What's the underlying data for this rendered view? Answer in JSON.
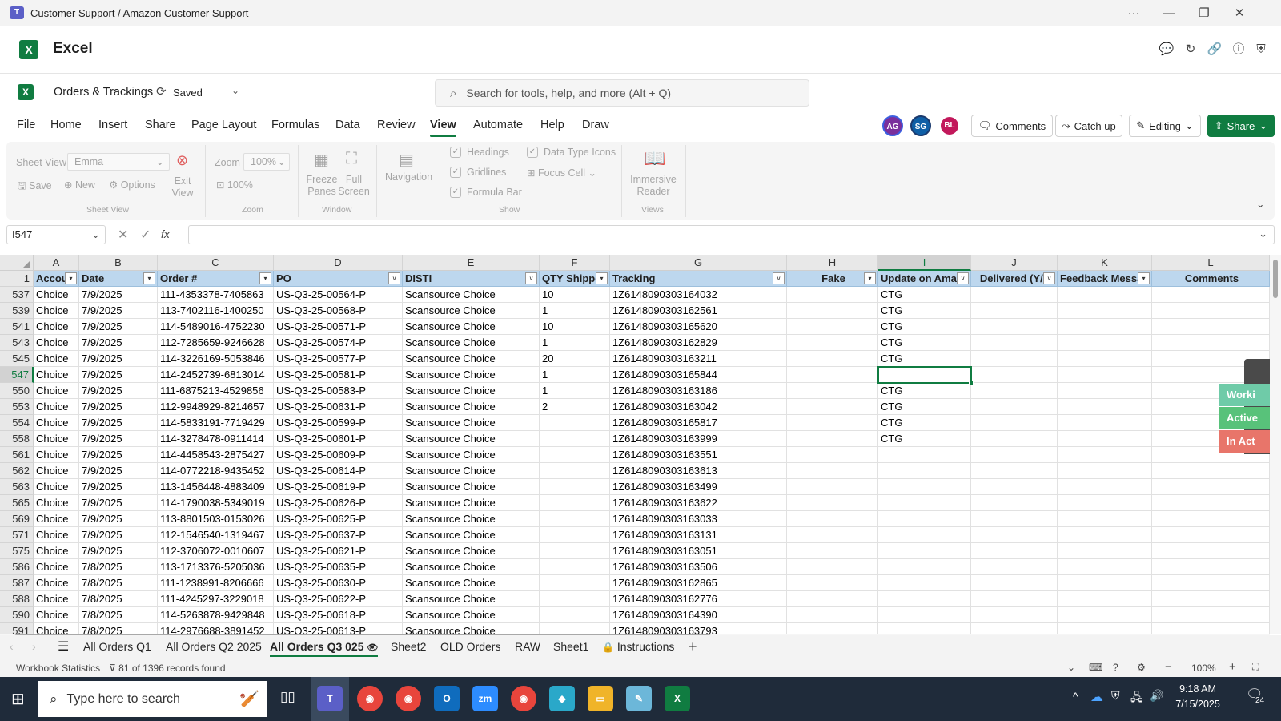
{
  "window": {
    "title": "Customer Support / Amazon Customer Support",
    "more": "···",
    "minimize": "—",
    "restore": "❐",
    "close": "✕"
  },
  "app": {
    "name": "Excel",
    "logo": "X"
  },
  "doc": {
    "name": "Orders & Trackings",
    "saved": "Saved",
    "search_placeholder": "Search for tools, help, and more (Alt + Q)"
  },
  "menu": [
    "File",
    "Home",
    "Insert",
    "Share",
    "Page Layout",
    "Formulas",
    "Data",
    "Review",
    "View",
    "Automate",
    "Help",
    "Draw"
  ],
  "avatars": [
    {
      "initials": "AG",
      "color": "#7a2f9c"
    },
    {
      "initials": "SG",
      "color": "#0f5fa6"
    },
    {
      "initials": "BL",
      "color": "#c2185b"
    }
  ],
  "actions": {
    "comments": "Comments",
    "catchup": "Catch up",
    "editing": "Editing",
    "share": "Share"
  },
  "ribbon": {
    "sheet_view_label": "Sheet View",
    "sheet_view_value": "Emma",
    "save": "Save",
    "new": "New",
    "options": "Options",
    "exit_view": "Exit View",
    "group_sheet_view": "Sheet View",
    "zoom_label": "Zoom",
    "zoom_value": "100%",
    "zoom_100": "100%",
    "group_zoom": "Zoom",
    "freeze_panes": "Freeze Panes",
    "full_screen": "Full Screen",
    "group_window": "Window",
    "navigation": "Navigation",
    "headings": "Headings",
    "gridlines": "Gridlines",
    "formula_bar": "Formula Bar",
    "data_type_icons": "Data Type Icons",
    "focus_cell": "Focus Cell",
    "group_show": "Show",
    "immersive_reader": "Immersive Reader",
    "group_views": "Views"
  },
  "formula_bar": {
    "name_box": "I547",
    "fx": "fx",
    "content": ""
  },
  "grid": {
    "columns": [
      "A",
      "B",
      "C",
      "D",
      "E",
      "F",
      "G",
      "H",
      "I",
      "J",
      "K",
      "L"
    ],
    "header_row_num": "1",
    "headers": [
      "Accou",
      "Date",
      "Order #",
      "PO",
      "DISTI",
      "QTY Shipped",
      "Tracking",
      "Fake",
      "Update on Amaz",
      "Delivered (Y/N",
      "Feedback Messa",
      "Comments"
    ],
    "rows": [
      {
        "num": "537",
        "cells": [
          "Choice",
          "7/9/2025",
          "111-4353378-7405863",
          "US-Q3-25-00564-P",
          "Scansource Choice",
          "10",
          "1Z6148090303164032",
          "",
          "CTG",
          "",
          "",
          ""
        ]
      },
      {
        "num": "539",
        "cells": [
          "Choice",
          "7/9/2025",
          "113-7402116-1400250",
          "US-Q3-25-00568-P",
          "Scansource Choice",
          "1",
          "1Z6148090303162561",
          "",
          "CTG",
          "",
          "",
          ""
        ]
      },
      {
        "num": "541",
        "cells": [
          "Choice",
          "7/9/2025",
          "114-5489016-4752230",
          "US-Q3-25-00571-P",
          "Scansource Choice",
          "10",
          "1Z6148090303165620",
          "",
          "CTG",
          "",
          "",
          ""
        ]
      },
      {
        "num": "543",
        "cells": [
          "Choice",
          "7/9/2025",
          "112-7285659-9246628",
          "US-Q3-25-00574-P",
          "Scansource Choice",
          "1",
          "1Z6148090303162829",
          "",
          "CTG",
          "",
          "",
          ""
        ]
      },
      {
        "num": "545",
        "cells": [
          "Choice",
          "7/9/2025",
          "114-3226169-5053846",
          "US-Q3-25-00577-P",
          "Scansource Choice",
          "20",
          "1Z6148090303163211",
          "",
          "CTG",
          "",
          "",
          ""
        ]
      },
      {
        "num": "547",
        "cells": [
          "Choice",
          "7/9/2025",
          "114-2452739-6813014",
          "US-Q3-25-00581-P",
          "Scansource Choice",
          "1",
          "1Z6148090303165844",
          "",
          "",
          "",
          "",
          ""
        ]
      },
      {
        "num": "550",
        "cells": [
          "Choice",
          "7/9/2025",
          "111-6875213-4529856",
          "US-Q3-25-00583-P",
          "Scansource Choice",
          "1",
          "1Z6148090303163186",
          "",
          "CTG",
          "",
          "",
          ""
        ]
      },
      {
        "num": "553",
        "cells": [
          "Choice",
          "7/9/2025",
          "112-9948929-8214657",
          "US-Q3-25-00631-P",
          "Scansource Choice",
          "2",
          "1Z6148090303163042",
          "",
          "CTG",
          "",
          "",
          ""
        ]
      },
      {
        "num": "554",
        "cells": [
          "Choice",
          "7/9/2025",
          "114-5833191-7719429",
          "US-Q3-25-00599-P",
          "Scansource Choice",
          "",
          "1Z6148090303165817",
          "",
          "CTG",
          "",
          "",
          ""
        ]
      },
      {
        "num": "558",
        "cells": [
          "Choice",
          "7/9/2025",
          "114-3278478-0911414",
          "US-Q3-25-00601-P",
          "Scansource Choice",
          "",
          "1Z6148090303163999",
          "",
          "CTG",
          "",
          "",
          ""
        ]
      },
      {
        "num": "561",
        "cells": [
          "Choice",
          "7/9/2025",
          "114-4458543-2875427",
          "US-Q3-25-00609-P",
          "Scansource Choice",
          "",
          "1Z6148090303163551",
          "",
          "",
          "",
          "",
          ""
        ]
      },
      {
        "num": "562",
        "cells": [
          "Choice",
          "7/9/2025",
          "114-0772218-9435452",
          "US-Q3-25-00614-P",
          "Scansource Choice",
          "",
          "1Z6148090303163613",
          "",
          "",
          "",
          "",
          ""
        ]
      },
      {
        "num": "563",
        "cells": [
          "Choice",
          "7/9/2025",
          "113-1456448-4883409",
          "US-Q3-25-00619-P",
          "Scansource Choice",
          "",
          "1Z6148090303163499",
          "",
          "",
          "",
          "",
          ""
        ]
      },
      {
        "num": "565",
        "cells": [
          "Choice",
          "7/9/2025",
          "114-1790038-5349019",
          "US-Q3-25-00626-P",
          "Scansource Choice",
          "",
          "1Z6148090303163622",
          "",
          "",
          "",
          "",
          ""
        ]
      },
      {
        "num": "569",
        "cells": [
          "Choice",
          "7/9/2025",
          "113-8801503-0153026",
          "US-Q3-25-00625-P",
          "Scansource Choice",
          "",
          "1Z6148090303163033",
          "",
          "",
          "",
          "",
          ""
        ]
      },
      {
        "num": "571",
        "cells": [
          "Choice",
          "7/9/2025",
          "112-1546540-1319467",
          "US-Q3-25-00637-P",
          "Scansource Choice",
          "",
          "1Z6148090303163131",
          "",
          "",
          "",
          "",
          ""
        ]
      },
      {
        "num": "575",
        "cells": [
          "Choice",
          "7/9/2025",
          "112-3706072-0010607",
          "US-Q3-25-00621-P",
          "Scansource Choice",
          "",
          "1Z6148090303163051",
          "",
          "",
          "",
          "",
          ""
        ]
      },
      {
        "num": "586",
        "cells": [
          "Choice",
          "7/8/2025",
          "113-1713376-5205036",
          "US-Q3-25-00635-P",
          "Scansource Choice",
          "",
          "1Z6148090303163506",
          "",
          "",
          "",
          "",
          ""
        ]
      },
      {
        "num": "587",
        "cells": [
          "Choice",
          "7/8/2025",
          "111-1238991-8206666",
          "US-Q3-25-00630-P",
          "Scansource Choice",
          "",
          "1Z6148090303162865",
          "",
          "",
          "",
          "",
          ""
        ]
      },
      {
        "num": "588",
        "cells": [
          "Choice",
          "7/8/2025",
          "111-4245297-3229018",
          "US-Q3-25-00622-P",
          "Scansource Choice",
          "",
          "1Z6148090303162776",
          "",
          "",
          "",
          "",
          ""
        ]
      },
      {
        "num": "590",
        "cells": [
          "Choice",
          "7/8/2025",
          "114-5263878-9429848",
          "US-Q3-25-00618-P",
          "Scansource Choice",
          "",
          "1Z6148090303164390",
          "",
          "",
          "",
          "",
          ""
        ]
      },
      {
        "num": "591",
        "cells": [
          "Choice",
          "7/8/2025",
          "114-2976688-3891452",
          "US-Q3-25-00613-P",
          "Scansource Choice",
          "",
          "1Z6148090303163793",
          "",
          "",
          "",
          "",
          ""
        ]
      }
    ]
  },
  "side_panel": [
    {
      "label": "Worki",
      "color": "#6fcba8"
    },
    {
      "label": "Active",
      "color": "#58c27a"
    },
    {
      "label": "In Act",
      "color": "#e8756a"
    }
  ],
  "sheet_tabs": [
    "All Orders Q1",
    "All Orders Q2 2025",
    "All Orders Q3 025",
    "Sheet2",
    "OLD Orders",
    "RAW",
    "Sheet1",
    "Instructions"
  ],
  "active_tab": "All Orders Q3 025",
  "status": {
    "stats": "Workbook Statistics",
    "filter": "81 of 1396 records found",
    "zoom": "100%"
  },
  "taskbar": {
    "search_placeholder": "Type here to search",
    "time": "9:18 AM",
    "date": "7/15/2025",
    "notif_count": "24"
  }
}
